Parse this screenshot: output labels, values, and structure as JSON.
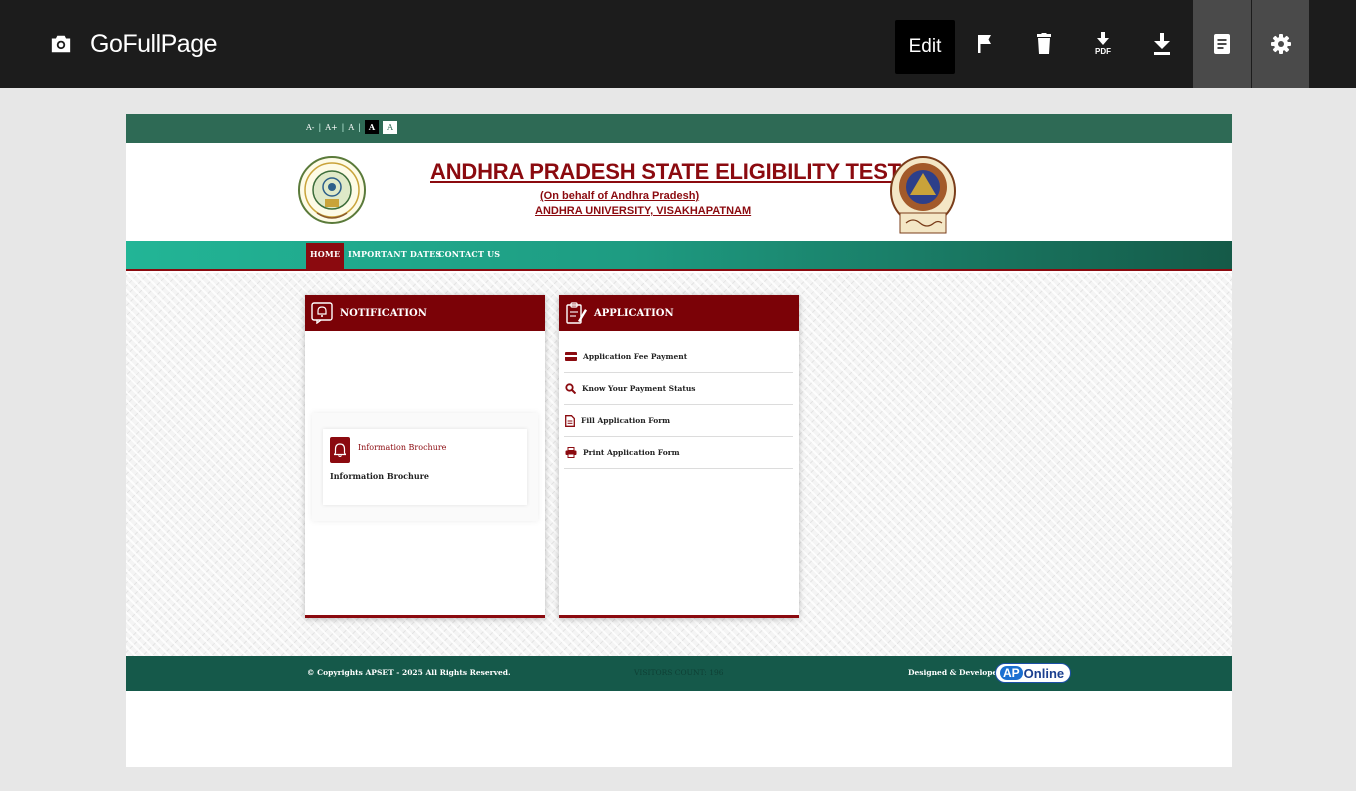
{
  "toolbar": {
    "app_name": "GoFullPage",
    "edit_label": "Edit",
    "icons": [
      "camera-icon",
      "flag-icon",
      "trash-icon",
      "download-pdf-icon",
      "download-icon",
      "document-icon",
      "gear-icon"
    ],
    "pdf_label": "PDF"
  },
  "site": {
    "accessibility": {
      "decrease": "A-",
      "increase": "A+",
      "reset": "A",
      "dark": "A",
      "light": "A"
    },
    "header": {
      "title": "ANDHRA PRADESH STATE ELIGIBILITY TEST",
      "subtitle": "(On behalf of Andhra Pradesh)",
      "university": "ANDHRA UNIVERSITY, VISAKHAPATNAM"
    },
    "nav": [
      "HOME",
      "IMPORTANT DATES",
      "CONTACT US"
    ],
    "notification": {
      "title": "NOTIFICATION",
      "item_link": "Information Brochure",
      "item_text": "Information Brochure"
    },
    "application": {
      "title": "APPLICATION",
      "items": [
        {
          "label": "Application Fee Payment",
          "icon": "credit-card-icon"
        },
        {
          "label": "Know Your Payment Status",
          "icon": "search-icon"
        },
        {
          "label": "Fill Application Form",
          "icon": "file-text-icon"
        },
        {
          "label": "Print Application Form",
          "icon": "print-icon"
        }
      ]
    },
    "footer": {
      "copyright": "© Copyrights APSET - 2025 All Rights Reserved.",
      "visitors": "VISITORS COUNT: 196",
      "designed_by": "Designed & Developed by",
      "logo_ap": "AP",
      "logo_online": "Online"
    }
  },
  "colors": {
    "toolbar_bg": "#1c1c1c",
    "accent_maroon": "#7b0207",
    "nav_teal": "#22b596",
    "footer_green": "#15594a"
  }
}
